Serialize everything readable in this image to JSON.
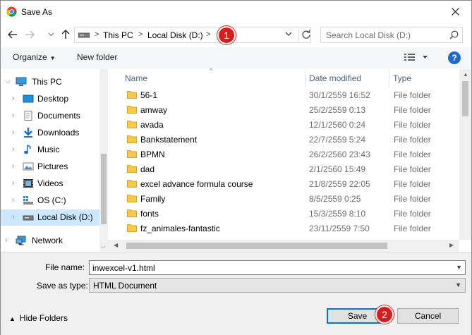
{
  "window": {
    "title": "Save As"
  },
  "colors": {
    "accent": "#0078d7",
    "selection": "#cce8ff",
    "folder": "#f8c94a",
    "badge": "#d61d1d"
  },
  "address": {
    "crumbs": [
      "This PC",
      "Local Disk (D:)"
    ],
    "separator": ">"
  },
  "search": {
    "placeholder": "Search Local Disk (D:)"
  },
  "toolbar": {
    "organize_label": "Organize",
    "new_folder_label": "New folder",
    "help_label": "?"
  },
  "nav": {
    "items": [
      {
        "label": "This PC",
        "icon": "computer-icon"
      },
      {
        "label": "Desktop",
        "icon": "desktop-icon"
      },
      {
        "label": "Documents",
        "icon": "documents-icon"
      },
      {
        "label": "Downloads",
        "icon": "downloads-icon"
      },
      {
        "label": "Music",
        "icon": "music-icon"
      },
      {
        "label": "Pictures",
        "icon": "pictures-icon"
      },
      {
        "label": "Videos",
        "icon": "videos-icon"
      },
      {
        "label": "OS (C:)",
        "icon": "os-drive-icon"
      },
      {
        "label": "Local Disk (D:)",
        "icon": "drive-icon"
      },
      {
        "label": "Network",
        "icon": "network-icon"
      }
    ]
  },
  "columns": {
    "name": "Name",
    "date": "Date modified",
    "type": "Type"
  },
  "files": [
    {
      "name": "56-1",
      "date": "30/1/2559 16:52",
      "type": "File folder"
    },
    {
      "name": "amway",
      "date": "25/2/2559 0:13",
      "type": "File folder"
    },
    {
      "name": "avada",
      "date": "12/1/2560 0:24",
      "type": "File folder"
    },
    {
      "name": "Bankstatement",
      "date": "22/7/2559 5:24",
      "type": "File folder"
    },
    {
      "name": "BPMN",
      "date": "26/2/2560 23:43",
      "type": "File folder"
    },
    {
      "name": "dad",
      "date": "2/1/2560 15:49",
      "type": "File folder"
    },
    {
      "name": "excel advance formula course",
      "date": "21/8/2559 22:05",
      "type": "File folder"
    },
    {
      "name": "Family",
      "date": "8/5/2559 0:25",
      "type": "File folder"
    },
    {
      "name": "fonts",
      "date": "15/3/2559 8:10",
      "type": "File folder"
    },
    {
      "name": "fz_animales-fantastic",
      "date": "23/11/2559 7:50",
      "type": "File folder"
    }
  ],
  "form": {
    "filename_label": "File name:",
    "filename_value": "inwexcel-v1.html",
    "type_label": "Save as type:",
    "type_value": "HTML Document",
    "hide_folders_label": "Hide Folders",
    "save_label": "Save",
    "cancel_label": "Cancel"
  },
  "badges": {
    "one": "1",
    "two": "2"
  }
}
